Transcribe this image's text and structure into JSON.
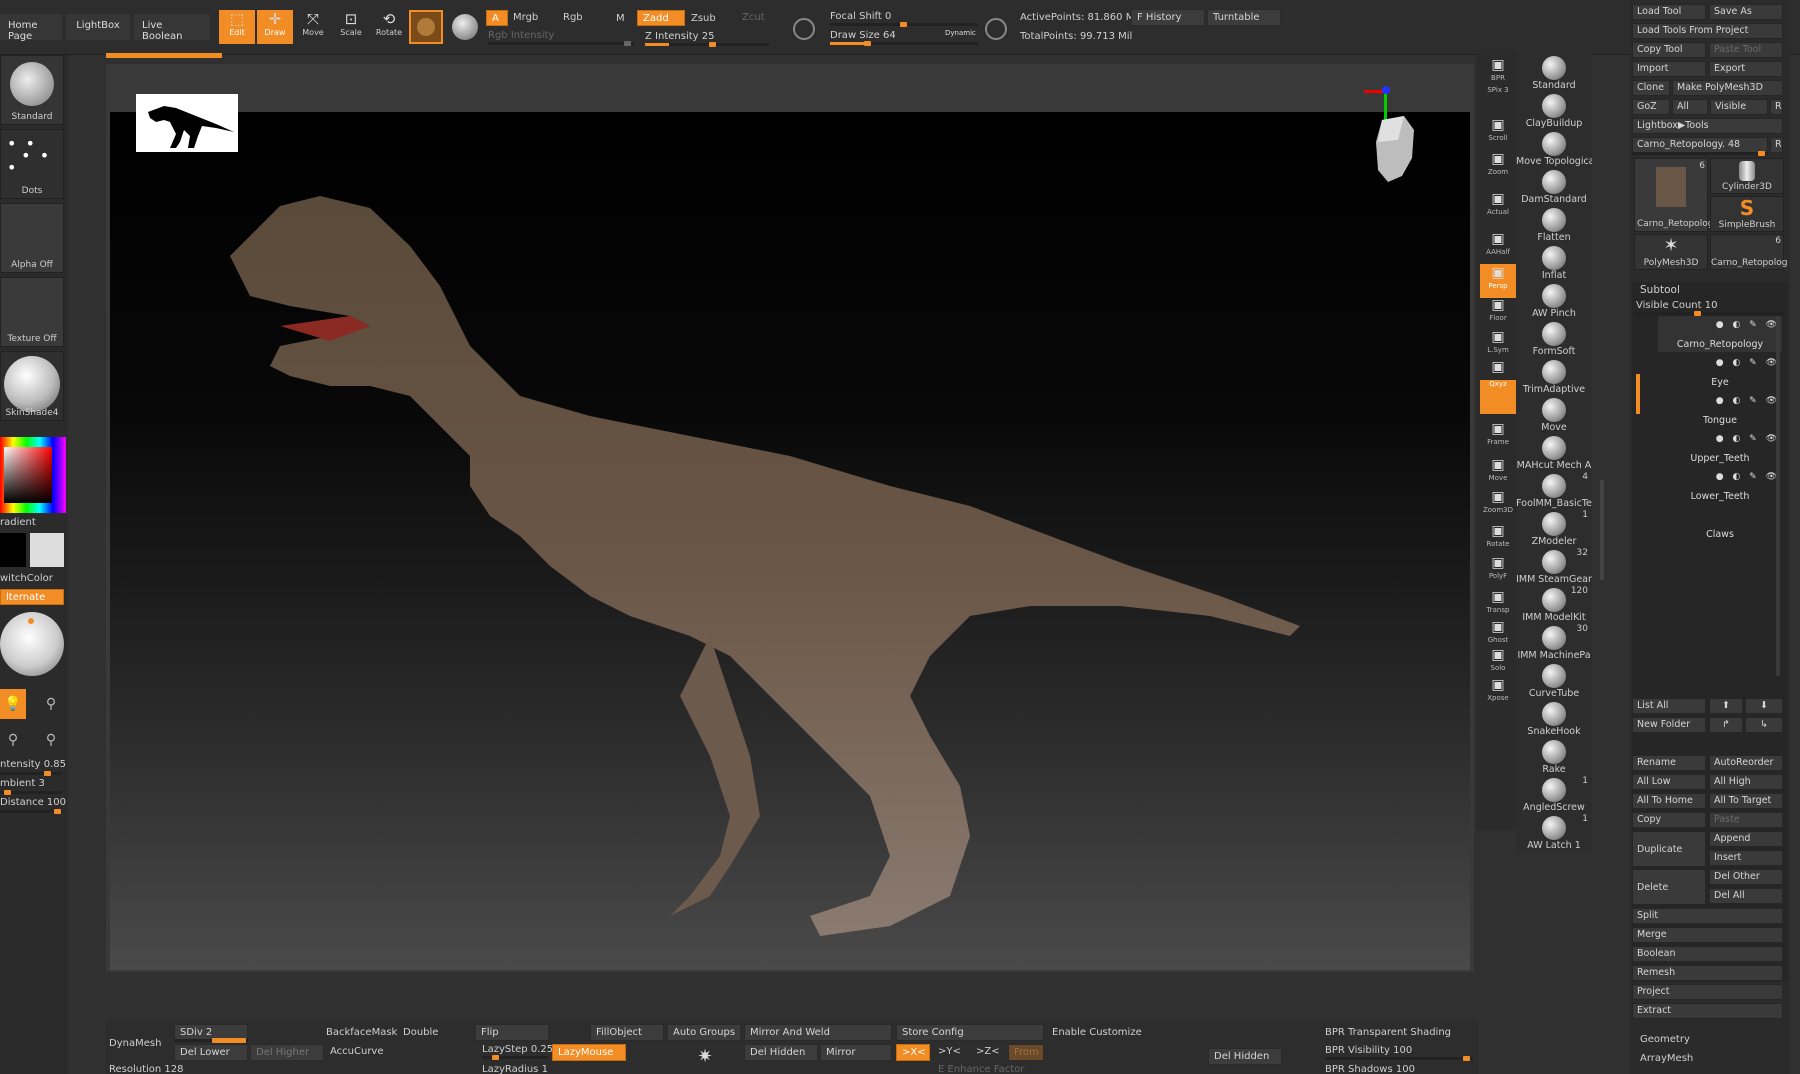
{
  "colors": {
    "accent": "#f28c24",
    "panel": "#2d2d2d",
    "button": "#3c3c3c"
  },
  "top": {
    "tabs": [
      "Home Page",
      "LightBox",
      "Live Boolean"
    ],
    "tools": [
      {
        "label": "Edit",
        "icon": "edit-icon",
        "active": true
      },
      {
        "label": "Draw",
        "icon": "draw-icon",
        "active": true
      },
      {
        "label": "Move",
        "icon": "move-icon"
      },
      {
        "label": "Scale",
        "icon": "scale-icon"
      },
      {
        "label": "Rotate",
        "icon": "rotate-icon"
      }
    ],
    "mode_a": "A",
    "mrgb": "Mrgb",
    "rgb": "Rgb",
    "m": "M",
    "zadd": "Zadd",
    "zsub": "Zsub",
    "zcut": "Zcut",
    "rgb_intensity": "Rgb Intensity",
    "z_intensity": "Z Intensity 25",
    "focal_shift": "Focal Shift 0",
    "draw_size": "Draw Size 64",
    "dynamic": "Dynamic",
    "active_points": "ActivePoints: 81.860 Mil",
    "total_points": "TotalPoints: 99.713 Mil",
    "f_history": "F History",
    "turntable": "Turntable"
  },
  "left": {
    "standard": "Standard",
    "dots": "Dots",
    "alpha_off": "Alpha Off",
    "texture_off": "Texture Off",
    "skinshade": "SkinShade4",
    "gradient": "radient",
    "switch_color": "witchColor",
    "alternate": "lternate",
    "intensity": "ntensity 0.85",
    "ambient": "mbient 3",
    "distance": "Distance 100"
  },
  "nav": [
    {
      "label": "BPR",
      "icon": "bpr-icon"
    },
    {
      "label": "SPix 3",
      "icon": ""
    },
    {
      "label": "Scroll",
      "icon": "scroll-icon"
    },
    {
      "label": "Zoom",
      "icon": "zoom-icon"
    },
    {
      "label": "Actual",
      "icon": "actual-icon"
    },
    {
      "label": "AAHalf",
      "icon": "aahalf-icon"
    },
    {
      "label": "Persp",
      "icon": "persp-icon",
      "active": true
    },
    {
      "label": "Floor",
      "icon": "floor-icon"
    },
    {
      "label": "L.Sym",
      "icon": "lsym-icon"
    },
    {
      "label": "",
      "icon": "lock-icon"
    },
    {
      "label": "Qxyz",
      "icon": "",
      "active": true
    },
    {
      "label": "Frame",
      "icon": "frame-icon"
    },
    {
      "label": "Move",
      "icon": "move-icon"
    },
    {
      "label": "Zoom3D",
      "icon": "zoom3d-icon"
    },
    {
      "label": "Rotate",
      "icon": "rotate-icon"
    },
    {
      "label": "PolyF",
      "icon": "polyf-icon"
    },
    {
      "label": "Transp",
      "icon": "transp-icon"
    },
    {
      "label": "Ghost",
      "icon": "ghost-icon"
    },
    {
      "label": "Solo",
      "icon": "solo-icon"
    },
    {
      "label": "Xpose",
      "icon": "xpose-icon"
    }
  ],
  "brushes": [
    {
      "name": "Standard"
    },
    {
      "name": "ClayBuildup"
    },
    {
      "name": "Move Topologica"
    },
    {
      "name": "DamStandard"
    },
    {
      "name": "Flatten"
    },
    {
      "name": "Inflat"
    },
    {
      "name": "AW Pinch"
    },
    {
      "name": "FormSoft"
    },
    {
      "name": "TrimAdaptive"
    },
    {
      "name": "Move"
    },
    {
      "name": "MAHcut Mech A"
    },
    {
      "name": "FoolMM_BasicTe",
      "count": "4"
    },
    {
      "name": "ZModeler",
      "count": "1"
    },
    {
      "name": "IMM SteamGear",
      "count": "32"
    },
    {
      "name": "IMM ModelKit",
      "count": "120"
    },
    {
      "name": "IMM MachinePa",
      "count": "30"
    },
    {
      "name": "CurveTube"
    },
    {
      "name": "SnakeHook"
    },
    {
      "name": "Rake"
    },
    {
      "name": "AngledScrew",
      "count": "1"
    },
    {
      "name": "AW Latch 1",
      "count": "1"
    }
  ],
  "panel": {
    "load_tool": "Load Tool",
    "save_as": "Save As",
    "load_tools_project": "Load Tools From Project",
    "copy_tool": "Copy Tool",
    "paste_tool": "Paste Tool",
    "import": "Import",
    "export": "Export",
    "clone": "Clone",
    "make_polymesh": "Make PolyMesh3D",
    "goz": "GoZ",
    "all": "All",
    "visible": "Visible",
    "r": "R",
    "lightbox_tools": "Lightbox▶Tools",
    "carno_slider": "Carno_Retopology. 48",
    "thumbs": [
      {
        "name": "Carno_Retopolog",
        "count": "6"
      },
      {
        "name": "Cylinder3D"
      },
      {
        "name": "SimpleBrush"
      },
      {
        "name": "PolyMesh3D"
      },
      {
        "name": "Carno_Retopolog",
        "count": "6"
      }
    ],
    "subtool_title": "Subtool",
    "visible_count": "Visible Count 10",
    "subtools": [
      "Carno_Retopology",
      "Eye",
      "Tongue",
      "Upper_Teeth",
      "Lower_Teeth",
      "Claws"
    ],
    "list_all": "List All",
    "new_folder": "New Folder",
    "rename": "Rename",
    "auto_reorder": "AutoReorder",
    "all_low": "All Low",
    "all_high": "All High",
    "all_to_home": "All To Home",
    "all_to_target": "All To Target",
    "copy": "Copy",
    "paste": "Paste",
    "duplicate": "Duplicate",
    "append": "Append",
    "insert": "Insert",
    "delete": "Delete",
    "del_other": "Del Other",
    "del_all": "Del All",
    "split": "Split",
    "merge": "Merge",
    "boolean": "Boolean",
    "remesh": "Remesh",
    "project": "Project",
    "extract": "Extract",
    "geometry": "Geometry",
    "arraymesh": "ArrayMesh"
  },
  "bottom": {
    "dynamesh": "DynaMesh",
    "resolution": "Resolution 128",
    "sdiv": "SDiv 2",
    "del_lower": "Del Lower",
    "del_higher": "Del Higher",
    "backfacemask": "BackfaceMask",
    "double": "Double",
    "accucurve": "AccuCurve",
    "flip": "Flip",
    "lazystep": "LazyStep 0.25",
    "lazymouse": "LazyMouse",
    "lazyradius": "LazyRadius 1",
    "fillobject": "FillObject",
    "auto_groups": "Auto Groups",
    "mirror_weld": "Mirror And Weld",
    "del_hidden": "Del Hidden",
    "mirror": "Mirror",
    "x": ">X<",
    "y": ">Y<",
    "z": ">Z<",
    "from": "From",
    "enhance": "E Enhance Factor",
    "store_config": "Store Config",
    "enable_customize": "Enable Customize",
    "del_hidden2": "Del Hidden",
    "bpr_transparent": "BPR Transparent Shading",
    "bpr_visibility": "BPR Visibility 100",
    "bpr_shadows": "BPR Shadows 100"
  }
}
